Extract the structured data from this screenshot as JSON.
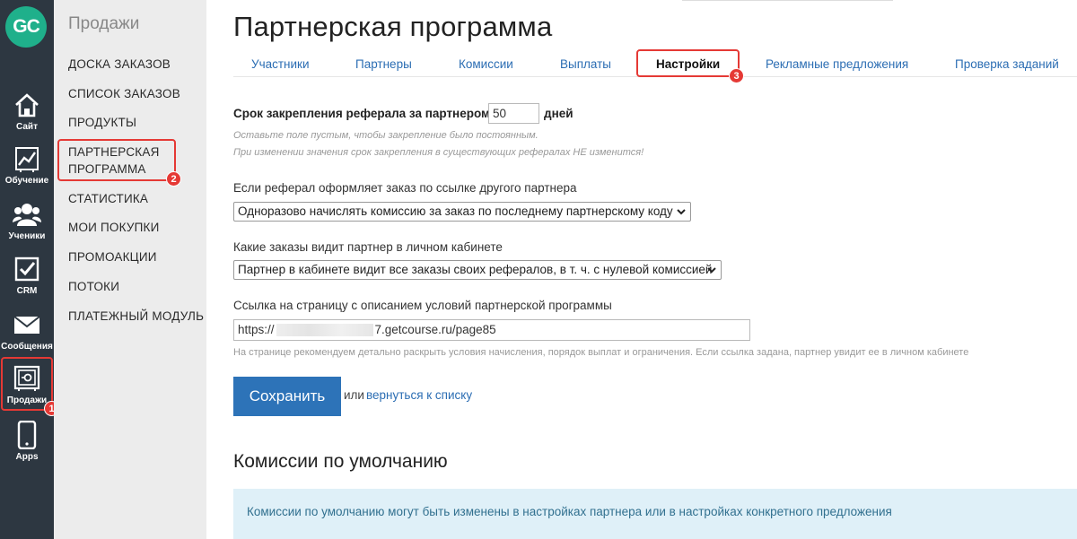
{
  "logo": {
    "text": "GC"
  },
  "iconbar": {
    "items": [
      {
        "label": "Сайт",
        "icon": "home-icon"
      },
      {
        "label": "Обучение",
        "icon": "chart-icon"
      },
      {
        "label": "Ученики",
        "icon": "users-icon"
      },
      {
        "label": "CRM",
        "icon": "checkbox-icon"
      },
      {
        "label": "Сообщения",
        "icon": "envelope-icon"
      },
      {
        "label": "Продажи",
        "icon": "safe-icon"
      },
      {
        "label": "Apps",
        "icon": "phone-icon"
      }
    ]
  },
  "submenu": {
    "title": "Продажи",
    "items": [
      "ДОСКА ЗАКАЗОВ",
      "СПИСОК ЗАКАЗОВ",
      "ПРОДУКТЫ",
      "ПАРТНЕРСКАЯ ПРОГРАММА",
      "СТАТИСТИКА",
      "МОИ ПОКУПКИ",
      "ПРОМОАКЦИИ",
      "ПОТОКИ",
      "ПЛАТЕЖНЫЙ МОДУЛЬ"
    ],
    "partner_line1": "ПАРТНЕРСКАЯ",
    "partner_line2": "ПРОГРАММА"
  },
  "badges": {
    "one": "1",
    "two": "2",
    "three": "3"
  },
  "page": {
    "title": "Партнерская программа",
    "tabs": [
      "Участники",
      "Партнеры",
      "Комиссии",
      "Выплаты",
      "Настройки",
      "Рекламные предложения",
      "Проверка заданий"
    ],
    "active_tab": "Настройки"
  },
  "form": {
    "referral_term_label": "Срок закрепления реферала за партнером",
    "referral_term_value": "50",
    "referral_term_unit": "дней",
    "hint1": "Оставьте поле пустым, чтобы закрепление было постоянным.",
    "hint2": "При изменении значения срок закрепления в существующих рефералах НЕ изменится!",
    "other_partner_label": "Если реферал оформляет заказ по ссылке другого партнера",
    "other_partner_value": "Одноразово начислять комиссию за заказ по последнему партнерскому коду",
    "visible_orders_label": "Какие заказы видит партнер в личном кабинете",
    "visible_orders_value": "Партнер в кабинете видит все заказы своих рефералов, в т. ч. с нулевой комиссией",
    "terms_link_label": "Ссылка на страницу с описанием условий партнерской программы",
    "terms_link_prefix": "https://",
    "terms_link_suffix": "7.getcourse.ru/page85",
    "terms_link_hint": "На странице рекомендуем детально раскрыть условия начисления, порядок выплат и ограничения. Если ссылка задана, партнер увидит ее в личном кабинете",
    "save_label": "Сохранить",
    "or_text": "или",
    "back_link": "вернуться к списку"
  },
  "default_commissions": {
    "title": "Комиссии по умолчанию",
    "info": "Комиссии по умолчанию могут быть изменены в настройках партнера или в настройках конкретного предложения"
  },
  "colors": {
    "iconbar_bg": "#2d3741",
    "logo": "#1fb08b",
    "accent_blue": "#2d73b8",
    "highlight_red": "#e53935",
    "info_bg": "#dff0f8"
  }
}
